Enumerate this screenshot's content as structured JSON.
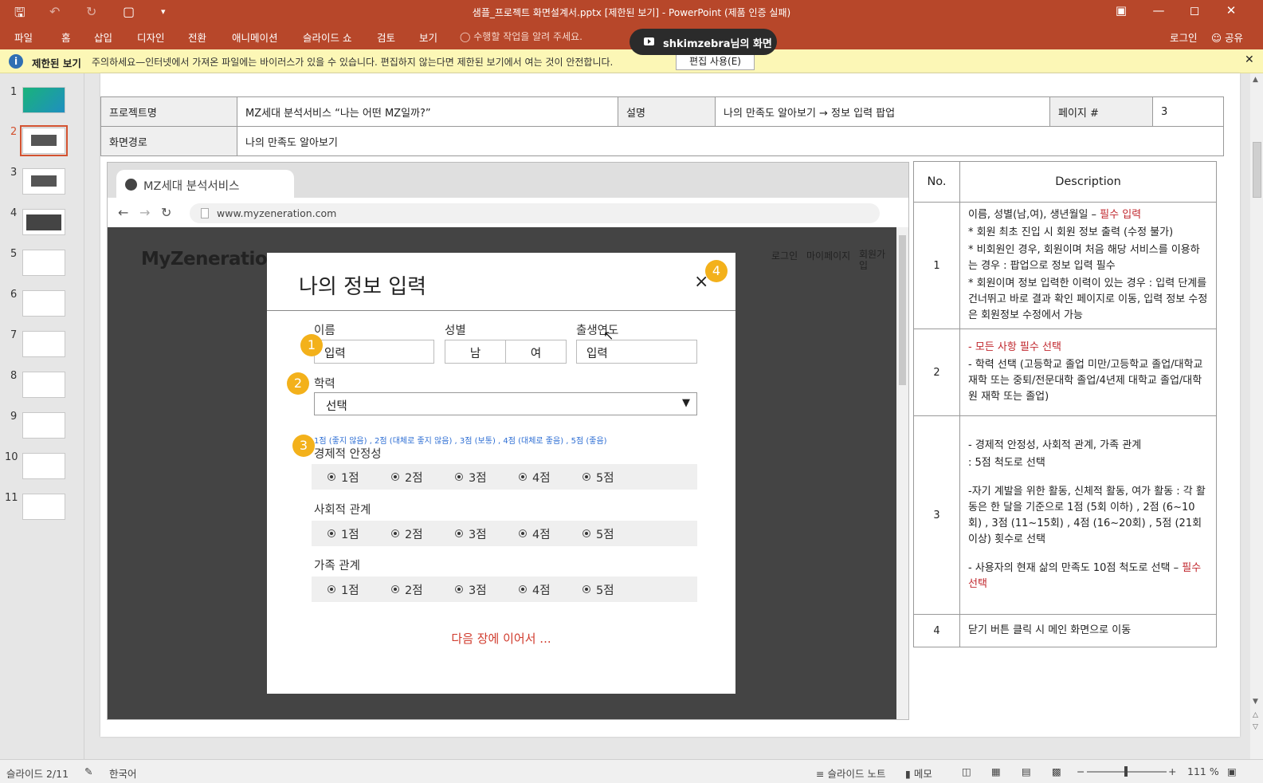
{
  "window": {
    "title": "샘플_프로젝트 화면설계서.pptx [제한된 보기] - PowerPoint (제품 인증 실패)"
  },
  "menu": [
    "파일",
    "홈",
    "삽입",
    "디자인",
    "전환",
    "애니메이션",
    "슬라이드 쇼",
    "검토",
    "보기"
  ],
  "tellme": "수행할 작업을 알려 주세요.",
  "share_pill": "shkimzebra님의 화면",
  "login": "로그인",
  "share": "공유",
  "message_bar": {
    "title": "제한된 보기",
    "text": "주의하세요—인터넷에서 가져온 파일에는 바이러스가 있을 수 있습니다. 편집하지 않는다면 제한된 보기에서 여는 것이 안전합니다.",
    "button": "편집 사용(E)"
  },
  "thumbnails": [
    "1",
    "2",
    "3",
    "4",
    "5",
    "6",
    "7",
    "8",
    "9",
    "10",
    "11"
  ],
  "header_table": {
    "project_label": "프로젝트명",
    "project_value": "MZ세대 분석서비스 “나는 어떤 MZ일까?”",
    "desc_label": "설명",
    "desc_value": "나의 만족도 알아보기 → 정보 입력 팝업",
    "page_label": "페이지 #",
    "page_value": "3",
    "path_label": "화면경로",
    "path_value": "나의 만족도 알아보기"
  },
  "browser": {
    "tab": "MZ세대 분석서비스",
    "url": "www.myzeneration.com"
  },
  "site": {
    "logo": "MyZeneration",
    "links": [
      "로그인",
      "마이페이지",
      "회원가입"
    ]
  },
  "modal": {
    "title": "나의 정보 입력",
    "close": "×",
    "name_label": "이름",
    "name_value": "입력",
    "gender_label": "성별",
    "gender_male": "남",
    "gender_female": "여",
    "birth_label": "출생연도",
    "birth_value": "입력",
    "edu_label": "학력",
    "edu_value": "선택",
    "scale_hint": "1점 (좋지 않음) , 2점 (대체로 좋지 않음) , 3점 (보통) , 4점 (대체로 좋음) , 5점 (좋음)",
    "groups": [
      {
        "label": "경제적 안정성"
      },
      {
        "label": "사회적 관계"
      },
      {
        "label": "가족 관계"
      }
    ],
    "options": [
      "1점",
      "2점",
      "3점",
      "4점",
      "5점"
    ],
    "next": "다음 장에 이어서 ..."
  },
  "badges": [
    "1",
    "2",
    "3",
    "4"
  ],
  "description": {
    "no_header": "No.",
    "desc_header": "Description",
    "rows": [
      {
        "no": "1",
        "lines": [
          {
            "pre": "이름, 성별(남,여), 생년월일 – ",
            "red": "필수 입력"
          },
          {
            "pre": "* 회원 최초 진입 시 회원 정보 출력 (수정 불가)",
            "red": ""
          },
          {
            "pre": "* 비회원인 경우, 회원이며 처음 해당 서비스를 이용하는 경우 : 팝업으로 정보 입력 필수",
            "red": ""
          },
          {
            "pre": "* 회원이며 정보 입력한 이력이 있는 경우 : 입력 단계를 건너뛰고 바로 결과 확인 페이지로 이동, 입력 정보 수정은 회원정보 수정에서 가능",
            "red": ""
          }
        ]
      },
      {
        "no": "2",
        "lines": [
          {
            "pre": "",
            "red": "- 모든 사항 필수 선택"
          },
          {
            "pre": "- 학력 선택 (고등학교 졸업 미만/고등학교 졸업/대학교 재학 또는 중퇴/전문대학 졸업/4년제 대학교 졸업/대학원 재학 또는 졸업)",
            "red": ""
          }
        ]
      },
      {
        "no": "3",
        "lines": [
          {
            "pre": "- 경제적 안정성, 사회적 관계, 가족 관계",
            "red": ""
          },
          {
            "pre": ":  5점 척도로 선택",
            "red": ""
          },
          {
            "pre": "-자기 계발을 위한 활동, 신체적 활동, 여가 활동 : 각 활동은 한 달을 기준으로 1점 (5회 이하) , 2점 (6~10회) , 3점 (11~15회) , 4점 (16~20회) , 5점 (21회 이상) 횟수로 선택",
            "red": ""
          },
          {
            "pre": "- 사용자의 현재 삶의 만족도 10점 척도로 선택 – ",
            "red": "필수 선택"
          }
        ]
      },
      {
        "no": "4",
        "lines": [
          {
            "pre": "닫기 버튼 클릭 시 메인 화면으로 이동",
            "red": ""
          }
        ]
      }
    ]
  },
  "status": {
    "slide": "슬라이드 2/11",
    "lang": "한국어",
    "notes": "슬라이드 노트",
    "memo": "메모",
    "zoom": "111 %"
  },
  "colors": {
    "ribbon": "#b7472a",
    "badge": "#f3b11b",
    "required": "#c0272d",
    "message_bar": "#fcf7b6"
  }
}
